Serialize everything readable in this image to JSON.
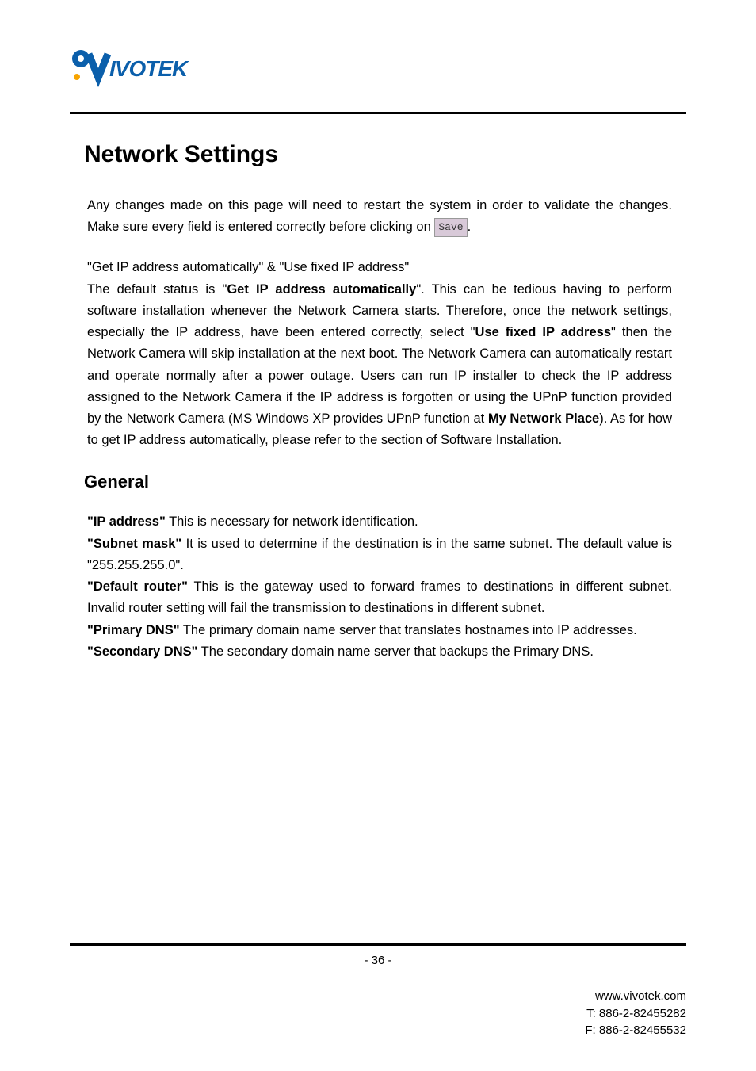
{
  "logo": {
    "brand": "VIVOTEK"
  },
  "title": "Network Settings",
  "intro_p1": "Any changes made on this page will need to restart the system in order to validate the changes. Make sure every field is entered correctly before clicking on ",
  "save_label": "Save",
  "intro_p1_end": ".",
  "getip_line": "\"Get IP address automatically\" & \"Use fixed IP address\"",
  "getip_para_a": "The default status is \"",
  "getip_bold1": "Get IP address automatically",
  "getip_para_b": "\". This can be tedious having to perform software installation whenever the Network Camera starts. Therefore, once the network settings, especially the IP address, have been entered correctly, select \"",
  "getip_bold2": "Use fixed IP address",
  "getip_para_c": "\" then the Network Camera will skip installation at the next boot. The Network Camera can automatically restart and operate normally after a power outage. Users can run IP installer to check the IP address assigned to the Network Camera if the IP address is forgotten or using the UPnP function provided by the Network Camera (MS Windows XP provides UPnP function at ",
  "getip_bold3": "My Network Place",
  "getip_para_d": "). As for how to get IP address automatically, please refer to the section of Software Installation.",
  "general_heading": "General",
  "defs": {
    "ip_label": "\"IP address\"",
    "ip_text": " This is necessary for network identification.",
    "subnet_label": "\"Subnet mask\"",
    "subnet_text": " It is used to determine if the destination is in the same subnet. The default value is \"255.255.255.0\".",
    "router_label": "\"Default router\"",
    "router_text": " This is the gateway used to forward frames to destinations in different subnet. Invalid router setting will fail the transmission to destinations in different subnet.",
    "pdns_label": "\"Primary DNS\"",
    "pdns_text": " The primary domain name server that translates hostnames into IP addresses.",
    "sdns_label": "\"Secondary DNS\"",
    "sdns_text": " The secondary domain name server that backups the Primary DNS."
  },
  "page_number": "- 36 -",
  "footer": {
    "url": "www.vivotek.com",
    "tel": "T: 886-2-82455282",
    "fax": "F: 886-2-82455532"
  }
}
